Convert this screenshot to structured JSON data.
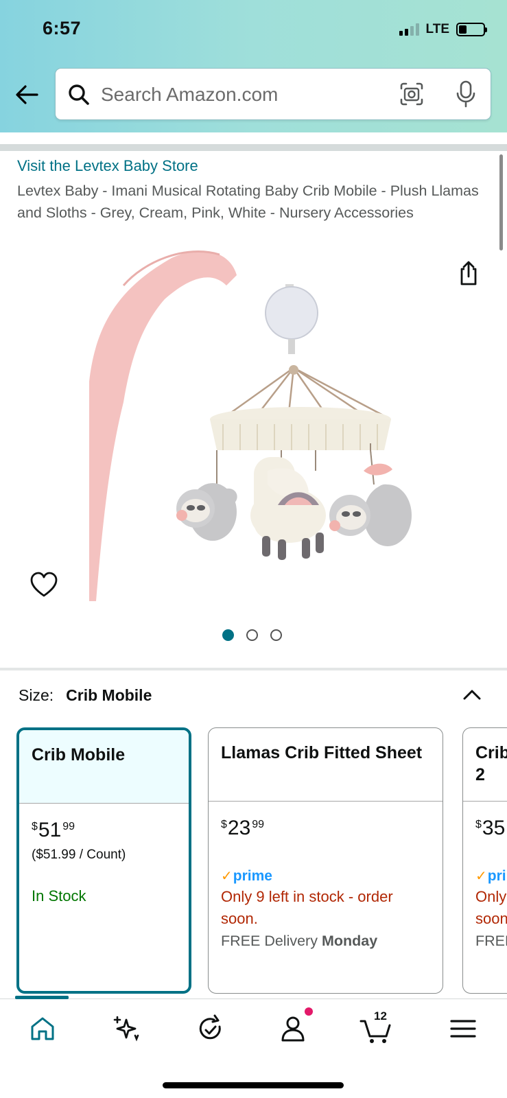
{
  "status_bar": {
    "time": "6:57",
    "network": "LTE"
  },
  "search": {
    "placeholder": "Search Amazon.com"
  },
  "product": {
    "store_link": "Visit the Levtex Baby Store",
    "title": "Levtex Baby - Imani Musical Rotating Baby Crib Mobile - Plush Llamas and Sloths - Grey, Cream, Pink, White - Nursery Accessories",
    "image_count": 3,
    "active_image": 1
  },
  "size_selector": {
    "label": "Size:",
    "selected": "Crib Mobile",
    "options": [
      {
        "name": "Crib Mobile",
        "price_whole": "51",
        "price_fraction": "99",
        "unit_price": "($51.99 / Count)",
        "availability": "In Stock",
        "selected": true
      },
      {
        "name": "Llamas Crib Fitted Sheet",
        "price_whole": "23",
        "price_fraction": "99",
        "prime": "prime",
        "availability": "Only 9 left in stock - order soon.",
        "delivery_prefix": "FREE Delivery",
        "delivery_day": "Monday"
      },
      {
        "name": "Crib",
        "name_line2": "2",
        "price_whole": "35",
        "prime": "pri",
        "availability": "Only",
        "availability_line2": "soon",
        "delivery_prefix": "FREE"
      }
    ]
  },
  "tab_bar": {
    "cart_count": "12"
  },
  "colors": {
    "accent": "#007185",
    "prime": "#1a98ff",
    "in_stock": "#007600",
    "low_stock": "#b12704"
  },
  "icons": [
    "back-arrow-icon",
    "search-icon",
    "camera-icon",
    "microphone-icon",
    "share-icon",
    "heart-icon",
    "chevron-up-icon",
    "home-icon",
    "ai-sparkle-icon",
    "reorder-icon",
    "account-icon",
    "cart-icon",
    "menu-icon"
  ]
}
